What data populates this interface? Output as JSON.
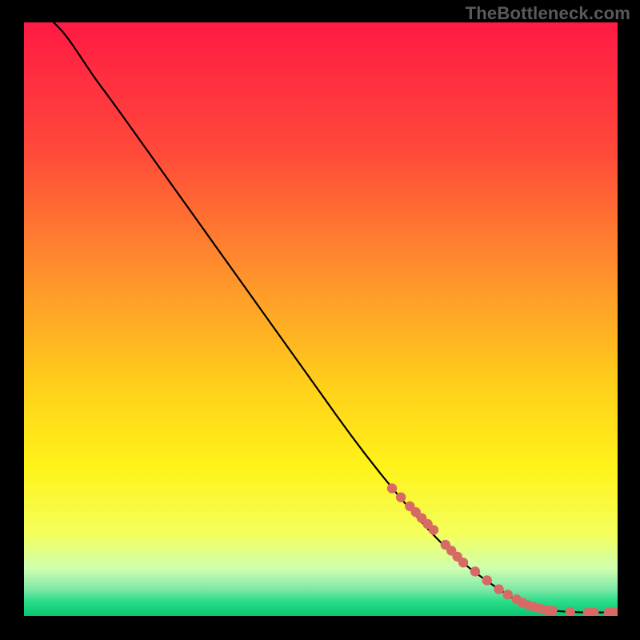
{
  "watermark": "TheBottleneck.com",
  "chart_data": {
    "type": "line",
    "title": "",
    "xlabel": "",
    "ylabel": "",
    "xlim": [
      0,
      100
    ],
    "ylim": [
      0,
      100
    ],
    "grid": false,
    "legend": false,
    "background_gradient": {
      "stops": [
        {
          "offset": 0.0,
          "color": "#ff1a44"
        },
        {
          "offset": 0.22,
          "color": "#ff4a3a"
        },
        {
          "offset": 0.45,
          "color": "#ff9a2a"
        },
        {
          "offset": 0.62,
          "color": "#ffd21a"
        },
        {
          "offset": 0.75,
          "color": "#fff31a"
        },
        {
          "offset": 0.86,
          "color": "#f4ff5a"
        },
        {
          "offset": 0.92,
          "color": "#cfffb0"
        },
        {
          "offset": 0.955,
          "color": "#7fe8a6"
        },
        {
          "offset": 0.975,
          "color": "#2bdd8a"
        },
        {
          "offset": 1.0,
          "color": "#09c56f"
        }
      ]
    },
    "series": [
      {
        "name": "curve",
        "type": "line",
        "color": "#000000",
        "x": [
          5.0,
          6.5,
          8.0,
          10.0,
          12.0,
          15.0,
          20.0,
          25.0,
          30.0,
          35.0,
          40.0,
          45.0,
          50.0,
          55.0,
          60.0,
          65.0,
          70.0,
          75.0,
          80.0,
          82.0,
          84.0,
          86.0,
          88.0,
          90.0,
          92.0,
          94.0,
          96.0,
          98.0,
          100.0
        ],
        "y": [
          100.0,
          98.5,
          96.5,
          93.5,
          90.5,
          86.5,
          79.5,
          72.5,
          65.5,
          58.5,
          51.5,
          44.5,
          37.5,
          30.5,
          24.0,
          18.0,
          12.5,
          8.0,
          4.5,
          3.2,
          2.2,
          1.5,
          1.0,
          0.8,
          0.7,
          0.6,
          0.6,
          0.6,
          0.6
        ]
      },
      {
        "name": "highlight-points",
        "type": "scatter",
        "color": "#d86a66",
        "x": [
          62.0,
          63.5,
          65.0,
          66.0,
          67.0,
          68.0,
          69.0,
          71.0,
          72.0,
          73.0,
          74.0,
          76.0,
          78.0,
          80.0,
          81.5,
          83.0,
          84.0,
          85.0,
          86.0,
          87.0,
          88.0,
          89.0,
          92.0,
          95.0,
          96.0,
          98.5,
          99.5
        ],
        "y": [
          21.5,
          20.0,
          18.5,
          17.5,
          16.5,
          15.5,
          14.5,
          12.0,
          11.0,
          10.0,
          9.0,
          7.5,
          6.0,
          4.5,
          3.6,
          2.8,
          2.2,
          1.8,
          1.5,
          1.2,
          1.0,
          0.9,
          0.7,
          0.6,
          0.6,
          0.6,
          0.6
        ]
      }
    ]
  }
}
